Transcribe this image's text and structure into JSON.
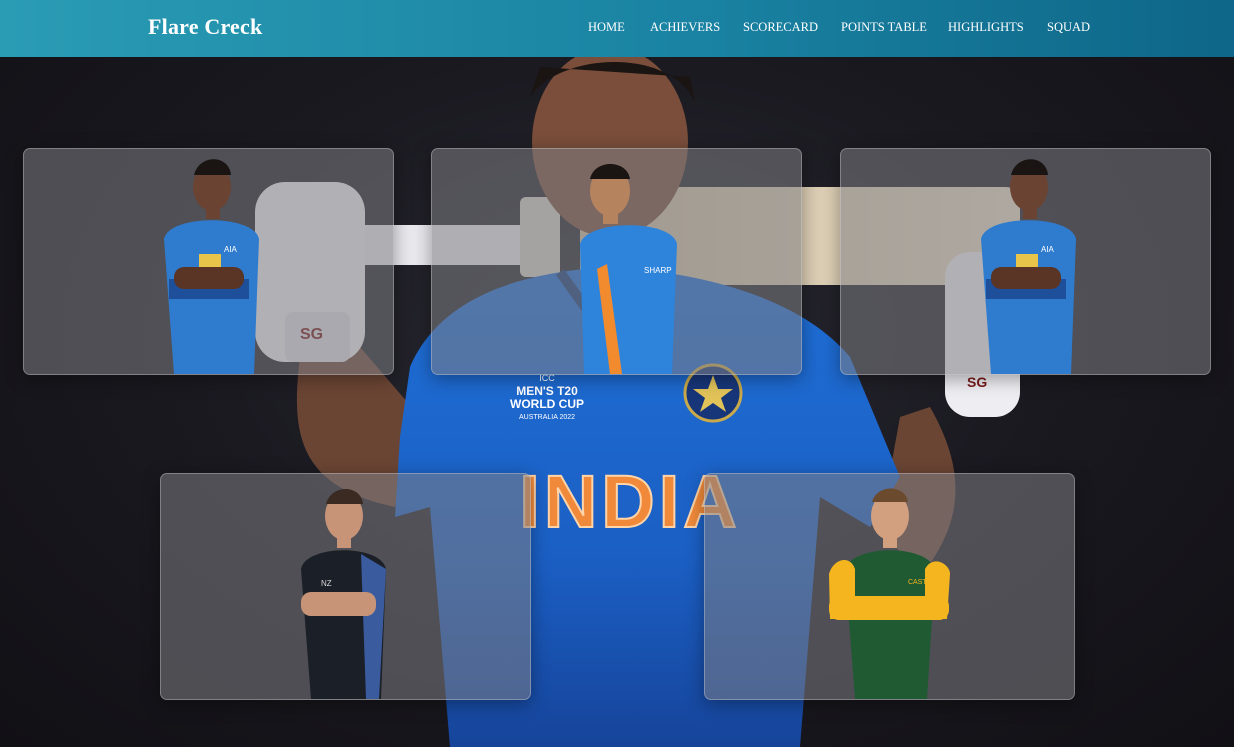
{
  "header": {
    "brand": "Flare Creck",
    "nav": [
      {
        "label": "HOME"
      },
      {
        "label": "ACHIEVERS"
      },
      {
        "label": "SCORECARD"
      },
      {
        "label": "POINTS TABLE"
      },
      {
        "label": "HIGHLIGHTS"
      },
      {
        "label": "SQUAD"
      }
    ]
  },
  "hero": {
    "jersey_text": "INDIA",
    "tournament_badge": [
      "ICC",
      "MEN'S T20",
      "WORLD CUP",
      "AUSTRALIA 2022"
    ],
    "bat_brand": "SG"
  },
  "players": [
    {
      "kit": "sri-lanka",
      "jersey": "#2f7ccf",
      "accent": "#1d4f9a",
      "crest_text": "AIA"
    },
    {
      "kit": "india",
      "jersey": "#2e84db",
      "accent": "#f28a2e",
      "crest_text": "SHARP"
    },
    {
      "kit": "sri-lanka",
      "jersey": "#2f7ccf",
      "accent": "#1d4f9a",
      "crest_text": "AIA"
    },
    {
      "kit": "new-zealand",
      "jersey": "#1b1f27",
      "accent": "#3a5c9e",
      "crest_text": "NZ"
    },
    {
      "kit": "south-africa",
      "jersey": "#1f5a33",
      "accent": "#f4b51f",
      "crest_text": "CASTLE"
    }
  ]
}
